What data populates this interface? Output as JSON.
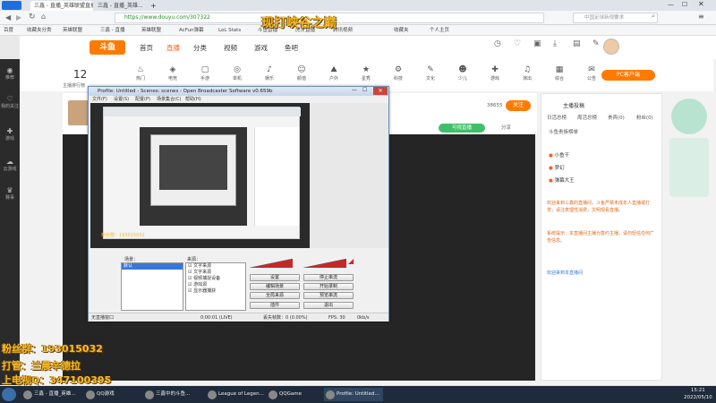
{
  "browser": {
    "tabs": [
      {
        "label": "三鑫 - 直播_英雄联盟直播_斗鱼",
        "active": true
      },
      {
        "label": "三鑫 - 直播_英雄...",
        "active": false
      }
    ],
    "url": "https://www.douyu.com/307322",
    "search_placeholder": "中国足球新规要求",
    "bookmarks": [
      "百度",
      "收藏夹分类",
      "英雄联盟",
      "三鑫 - 直播",
      "英雄联盟",
      "AcFun弹幕",
      "LoL Stats",
      "斗鱼直播",
      "虎牙直播",
      "腾讯视频",
      "收藏夹",
      "个人主页"
    ],
    "toolbar_icons": [
      "history-icon",
      "download-icon",
      "settings-icon",
      "menu-icon"
    ]
  },
  "douyu_header": {
    "logo": "斗鱼",
    "nav": [
      "首页",
      "直播",
      "分类",
      "视频",
      "游戏",
      "鱼吧"
    ],
    "active_nav": "直播",
    "user_icons": [
      "历史",
      "关注",
      "开播",
      "下载",
      "客户端",
      "任务",
      "消息"
    ]
  },
  "left_nav": [
    "推荐",
    "我的关注",
    "游戏",
    "云游戏",
    "赛事"
  ],
  "categories": {
    "number": "12",
    "subtitle": "主播排行榜",
    "items": [
      "热门",
      "电竞",
      "手游",
      "单机",
      "娱乐",
      "颜值",
      "户外",
      "星秀",
      "科技",
      "文化",
      "少儿",
      "游戏",
      "演出",
      "综合",
      "公告"
    ],
    "pc_button": "PC客户端"
  },
  "streamer": {
    "name": "三鑫",
    "follow_button": "关注",
    "fans": "38655",
    "level_badge": "可视直播",
    "share": "分享"
  },
  "overlay_title": "现打峡谷之巅",
  "overlay_lines": [
    "粉丝群：193015032",
    "打管：兰晨辛德拉",
    "上电视Q：347100395"
  ],
  "obs": {
    "title": "Profile: Untitled - Scenes: scenes - Open Broadcaster Software v0.659b",
    "menu": [
      "文件(F)",
      "设置(S)",
      "配置(P)",
      "场景集合(C)",
      "帮助(H)"
    ],
    "scene_label": "场景：",
    "scene_item": "默认",
    "source_label": "来源：",
    "sources": [
      "文字来源",
      "文字来源",
      "视频捕捉设备",
      "游戏源",
      "显示器捕获"
    ],
    "buttons": [
      "设置",
      "停止串流",
      "编辑场景",
      "开始录制",
      "全局来源",
      "预览串流",
      "插件",
      "退出"
    ],
    "status": "无直播窗口",
    "time": "0:00:01 (LIVE)",
    "dropped": "丢失帧数：0 (0.00%)",
    "fps": "FPS: 30",
    "bitrate": "0kb/s"
  },
  "chat": {
    "announce_title": "主播投稿",
    "tabs": [
      "日活总榜",
      "周活总榜",
      "贵宾(0)",
      "粉丝(0)"
    ],
    "rank_heading": "斗鱼贵族榜单",
    "rank_items": [
      "小鱼干",
      "梦幻",
      "弹幕大王"
    ],
    "chat_messages": [
      "欢迎来到三鑫的直播间，斗鱼严禁未成年人直播或打赏，请注意理性消费，文明观看直播。",
      "系统提示：本直播间主播为签约主播，请勿轻信任何广告信息。"
    ],
    "recent": "欢迎来到本直播间"
  },
  "taskbar": {
    "items": [
      "三鑫 - 直播_英雄...",
      "QQ游戏",
      "三鑫中的斗鱼...",
      "League of Legen...",
      "QQGame",
      "Profile: Untitled..."
    ],
    "clock": "15:21",
    "date": "2022/05/10"
  }
}
